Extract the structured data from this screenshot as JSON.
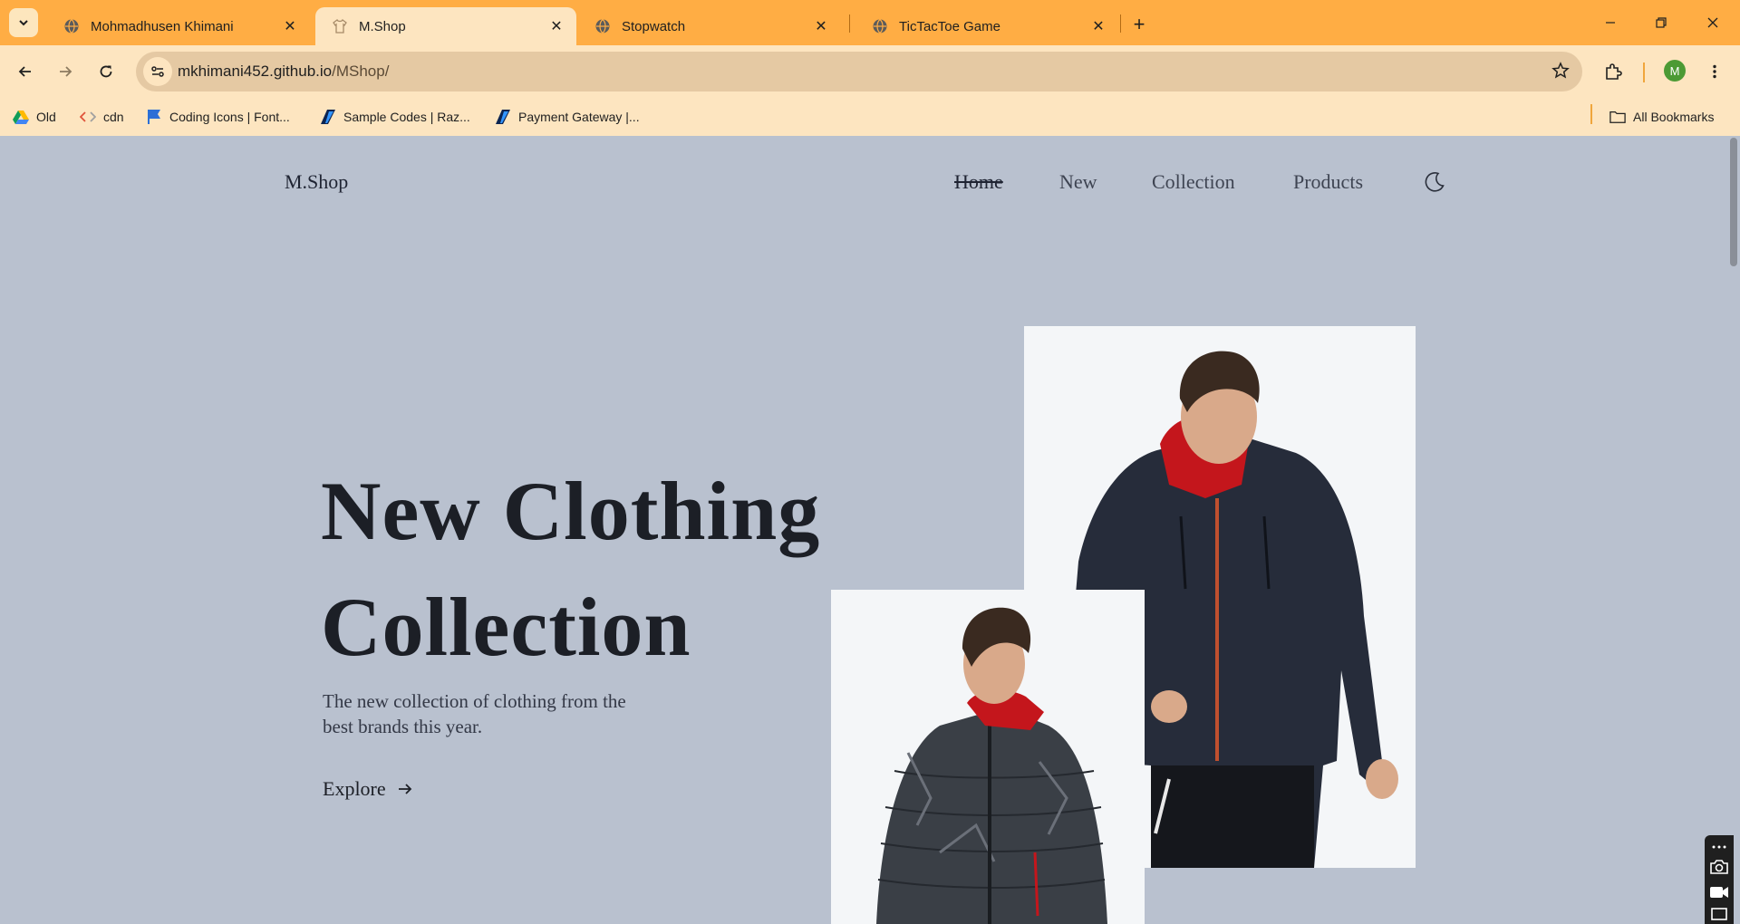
{
  "browser": {
    "tabs": [
      {
        "title": "Mohmadhusen Khimani",
        "icon": "globe-icon",
        "active": false
      },
      {
        "title": "M.Shop",
        "icon": "shirt-icon",
        "active": true
      },
      {
        "title": "Stopwatch",
        "icon": "globe-icon",
        "active": false
      },
      {
        "title": "TicTacToe Game",
        "icon": "globe-icon",
        "active": false
      }
    ],
    "address": {
      "host": "mkhimani452.github.io",
      "path": "/MShop/"
    },
    "profile_initial": "M",
    "bookmarks": [
      {
        "label": "Old",
        "icon": "drive-icon"
      },
      {
        "label": "cdn",
        "icon": "code-icon"
      },
      {
        "label": "Coding Icons | Font...",
        "icon": "flag-icon"
      },
      {
        "label": "Sample Codes | Raz...",
        "icon": "razorpay-icon"
      },
      {
        "label": "Payment Gateway |...",
        "icon": "razorpay-icon"
      }
    ],
    "all_bookmarks_label": "All Bookmarks",
    "colors": {
      "tabbar": "#ffad44",
      "toolbar": "#fde5c0"
    }
  },
  "site": {
    "logo": "M.Shop",
    "nav": [
      {
        "label": "Home",
        "current": true
      },
      {
        "label": "New",
        "current": false
      },
      {
        "label": "Collection",
        "current": false
      },
      {
        "label": "Products",
        "current": false
      }
    ],
    "theme_toggle_icon": "moon-icon",
    "hero": {
      "title_line1": "New Clothing",
      "title_line2": "Collection",
      "description": "The new collection of clothing from the best brands this year.",
      "cta_label": "Explore",
      "cta_icon": "arrow-right-icon"
    },
    "images": [
      {
        "name": "navy-hooded-jacket-model",
        "alt": "Man wearing navy hooded jacket with red zipper"
      },
      {
        "name": "camo-puffer-jacket-model",
        "alt": "Man wearing grey camo puffer jacket"
      }
    ],
    "colors": {
      "background": "#b9c1cf",
      "text": "#1c1f26"
    }
  }
}
